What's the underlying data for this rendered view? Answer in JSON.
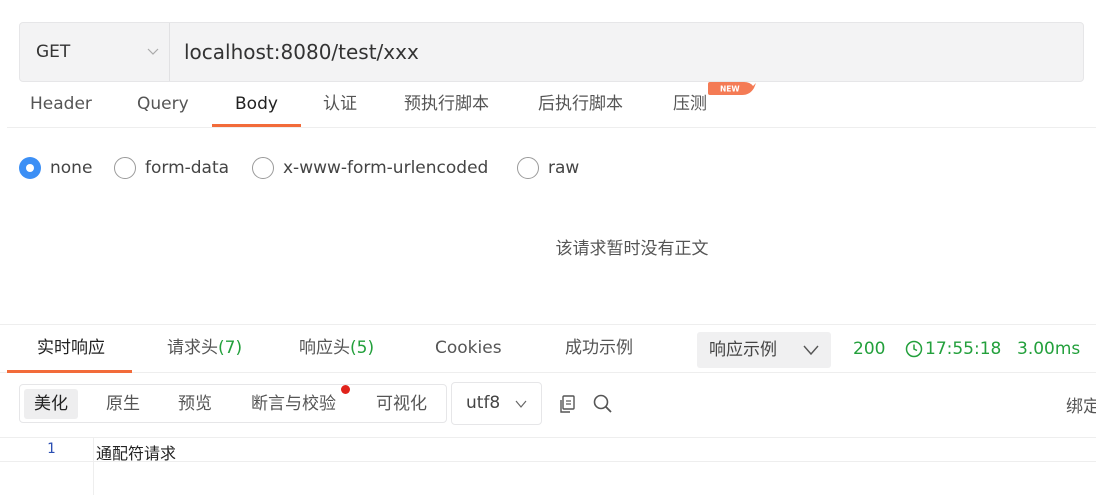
{
  "request": {
    "method": "GET",
    "url": "localhost:8080/test/xxx",
    "tabs": [
      {
        "label": "Header",
        "active": false
      },
      {
        "label": "Query",
        "active": false
      },
      {
        "label": "Body",
        "active": true
      },
      {
        "label": "认证",
        "active": false
      },
      {
        "label": "预执行脚本",
        "active": false
      },
      {
        "label": "后执行脚本",
        "active": false
      },
      {
        "label": "压测",
        "active": false
      }
    ],
    "new_badge": "NEW"
  },
  "body": {
    "options": [
      {
        "label": "none",
        "checked": true
      },
      {
        "label": "form-data",
        "checked": false
      },
      {
        "label": "x-www-form-urlencoded",
        "checked": false
      },
      {
        "label": "raw",
        "checked": false
      }
    ],
    "empty_message": "该请求暂时没有正文"
  },
  "response": {
    "tabs": [
      {
        "label": "实时响应",
        "count": "",
        "active": true
      },
      {
        "label": "请求头",
        "count": "(7)",
        "active": false
      },
      {
        "label": "响应头",
        "count": "(5)",
        "active": false
      },
      {
        "label": "Cookies",
        "count": "",
        "active": false
      },
      {
        "label": "成功示例",
        "count": "",
        "active": false
      }
    ],
    "example_select": "响应示例",
    "status_code": "200",
    "time": "17:55:18",
    "duration": "3.00ms",
    "status_color": "#23a03c"
  },
  "format_toolbar": {
    "modes": [
      {
        "label": "美化",
        "active": true
      },
      {
        "label": "原生",
        "active": false
      },
      {
        "label": "预览",
        "active": false
      },
      {
        "label": "断言与校验",
        "active": false
      },
      {
        "label": "可视化",
        "active": false
      }
    ],
    "encoding": "utf8",
    "bind_label": "绑定"
  },
  "code": {
    "lines": [
      {
        "number": "1",
        "text": "通配符请求"
      }
    ]
  },
  "colors": {
    "accent": "#f26b3a",
    "radio_checked": "#3c8ff5",
    "dot": "#e0231b"
  }
}
